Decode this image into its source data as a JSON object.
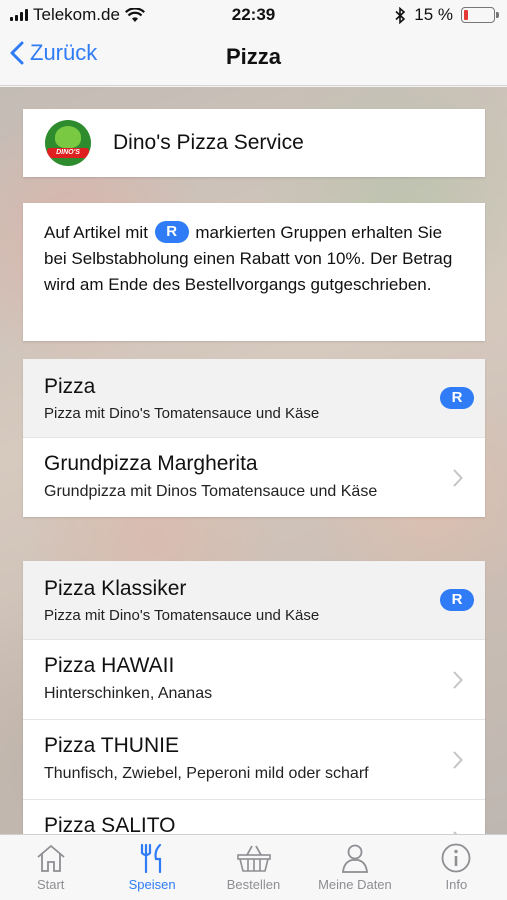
{
  "status_bar": {
    "carrier": "Telekom.de",
    "time": "22:39",
    "battery": "15 %",
    "battery_level": 0.15,
    "accent_low_battery": "#e53935"
  },
  "nav": {
    "back_label": "Zurück",
    "title": "Pizza"
  },
  "shop": {
    "name": "Dino's Pizza Service",
    "logo_text": "DINO'S"
  },
  "info": {
    "text_before": "Auf Artikel mit",
    "badge": "R",
    "text_after": "markierten Gruppen erhalten Sie bei Selbstabholung einen Rabatt von 10%. Der Betrag wird am Ende des Bestellvorgangs gutgeschrieben."
  },
  "groups": [
    {
      "title": "Pizza",
      "subtitle": "Pizza mit Dino's Tomatensauce und Käse",
      "badge": "R",
      "items": [
        {
          "title": "Grundpizza Margherita",
          "subtitle": "Grundpizza mit Dinos Tomatensauce und Käse"
        }
      ]
    },
    {
      "title": "Pizza Klassiker",
      "subtitle": "Pizza mit Dino's Tomatensauce und Käse",
      "badge": "R",
      "items": [
        {
          "title": "Pizza HAWAII",
          "subtitle": "Hinterschinken, Ananas"
        },
        {
          "title": "Pizza THUNIE",
          "subtitle": "Thunfisch, Zwiebel, Peperoni mild oder scharf"
        },
        {
          "title": "Pizza SALITO",
          "subtitle": ""
        }
      ]
    }
  ],
  "tabs": [
    {
      "label": "Start",
      "icon": "home-icon",
      "active": false
    },
    {
      "label": "Speisen",
      "icon": "cutlery-icon",
      "active": true
    },
    {
      "label": "Bestellen",
      "icon": "basket-icon",
      "active": false
    },
    {
      "label": "Meine Daten",
      "icon": "person-icon",
      "active": false
    },
    {
      "label": "Info",
      "icon": "info-icon",
      "active": false
    }
  ],
  "colors": {
    "accent": "#2f7cf6",
    "inactive_tab": "#8e8e93"
  }
}
